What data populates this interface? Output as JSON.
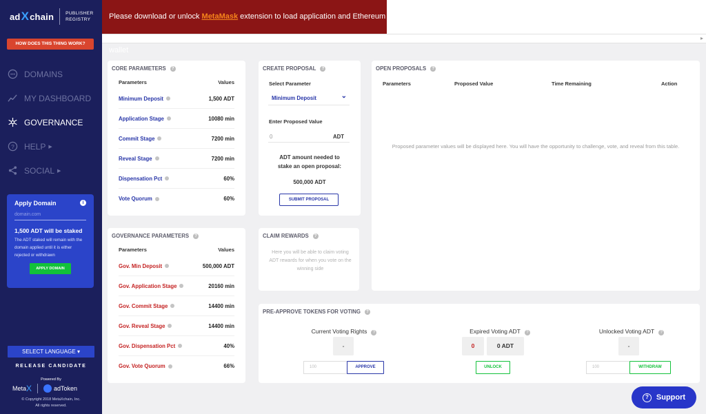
{
  "brand": {
    "left": "ad",
    "x": "X",
    "right": "chain",
    "sub_line1": "PUBLISHER",
    "sub_line2": "REGISTRY"
  },
  "how_button": "HOW DOES THIS THING WORK?",
  "nav": [
    {
      "label": "DOMAINS",
      "icon": "domains-icon"
    },
    {
      "label": "MY DASHBOARD",
      "icon": "dashboard-icon"
    },
    {
      "label": "GOVERNANCE",
      "icon": "governance-icon",
      "active": true
    },
    {
      "label": "HELP",
      "icon": "help-icon"
    },
    {
      "label": "SOCIAL",
      "icon": "share-icon"
    }
  ],
  "apply": {
    "title": "Apply Domain",
    "placeholder": "domain.com",
    "stake": "1,500 ADT will be staked",
    "note": "The ADT staked will remain with the domain applied until it is either rejected or withdrawn",
    "button": "APPLY DOMAIN"
  },
  "language_button": "SELECT LANGUAGE",
  "release": "RELEASE CANDIDATE",
  "footer": {
    "powered": "Powered By",
    "meta": "Meta",
    "meta_x": "X",
    "adtoken": "adToken",
    "copyright1": "© Copyright 2018 MetaXchain, Inc.",
    "copyright2": "All rights reserved."
  },
  "banner": {
    "pre": "Please download or unlock ",
    "link": "MetaMask",
    "post": " extension to load application and Ethereum wallet"
  },
  "core": {
    "title": "CORE PARAMETERS",
    "col1": "Parameters",
    "col2": "Values",
    "rows": [
      {
        "name": "Minimum Deposit",
        "value": "1,500 ADT"
      },
      {
        "name": "Application Stage",
        "value": "10080 min"
      },
      {
        "name": "Commit Stage",
        "value": "7200 min"
      },
      {
        "name": "Reveal Stage",
        "value": "7200 min"
      },
      {
        "name": "Dispensation Pct",
        "value": "60%"
      },
      {
        "name": "Vote Quorum",
        "value": "60%"
      }
    ]
  },
  "gov": {
    "title": "GOVERNANCE PARAMETERS",
    "col1": "Parameters",
    "col2": "Values",
    "rows": [
      {
        "name": "Gov. Min Deposit",
        "value": "500,000 ADT"
      },
      {
        "name": "Gov. Application Stage",
        "value": "20160 min"
      },
      {
        "name": "Gov. Commit Stage",
        "value": "14400 min"
      },
      {
        "name": "Gov. Reveal Stage",
        "value": "14400 min"
      },
      {
        "name": "Gov. Dispensation Pct",
        "value": "40%"
      },
      {
        "name": "Gov. Vote Quorum",
        "value": "66%"
      }
    ]
  },
  "create": {
    "title": "CREATE PROPOSAL",
    "select_label": "Select Parameter",
    "selected": "Minimum Deposit",
    "value_label": "Enter Proposed Value",
    "value_placeholder": "0",
    "unit": "ADT",
    "need_line1": "ADT amount needed to",
    "need_line2": "stake an open proposal:",
    "amount": "500,000 ADT",
    "submit": "SUBMIT PROPOSAL"
  },
  "claim": {
    "title": "CLAIM REWARDS",
    "text": "Here you will be able to claim voting ADT rewards for when you vote on the winning side"
  },
  "open": {
    "title": "OPEN PROPOSALS",
    "cols": [
      "Parameters",
      "Proposed Value",
      "Time Remaining",
      "Action"
    ],
    "empty": "Proposed parameter values will be displayed here. You will have the opportunity to challenge, vote, and reveal from this table."
  },
  "preapprove": {
    "title": "PRE-APPROVE TOKENS FOR VOTING",
    "current_label": "Current Voting Rights",
    "current_value": "-",
    "current_placeholder": "100",
    "approve": "APPROVE",
    "expired_label": "Expired Voting ADT",
    "expired_count": "0",
    "expired_value": "0 ADT",
    "unlock": "UNLOCK",
    "unlocked_label": "Unlocked Voting ADT",
    "unlocked_value": "-",
    "unlocked_placeholder": "100",
    "withdraw": "WITHDRAW"
  },
  "support": "Support",
  "colors": {
    "sidebar": "#1b1f5c",
    "accent": "#2836c9",
    "banner": "#8b1515",
    "green": "#12c13a",
    "red": "#c42222"
  }
}
